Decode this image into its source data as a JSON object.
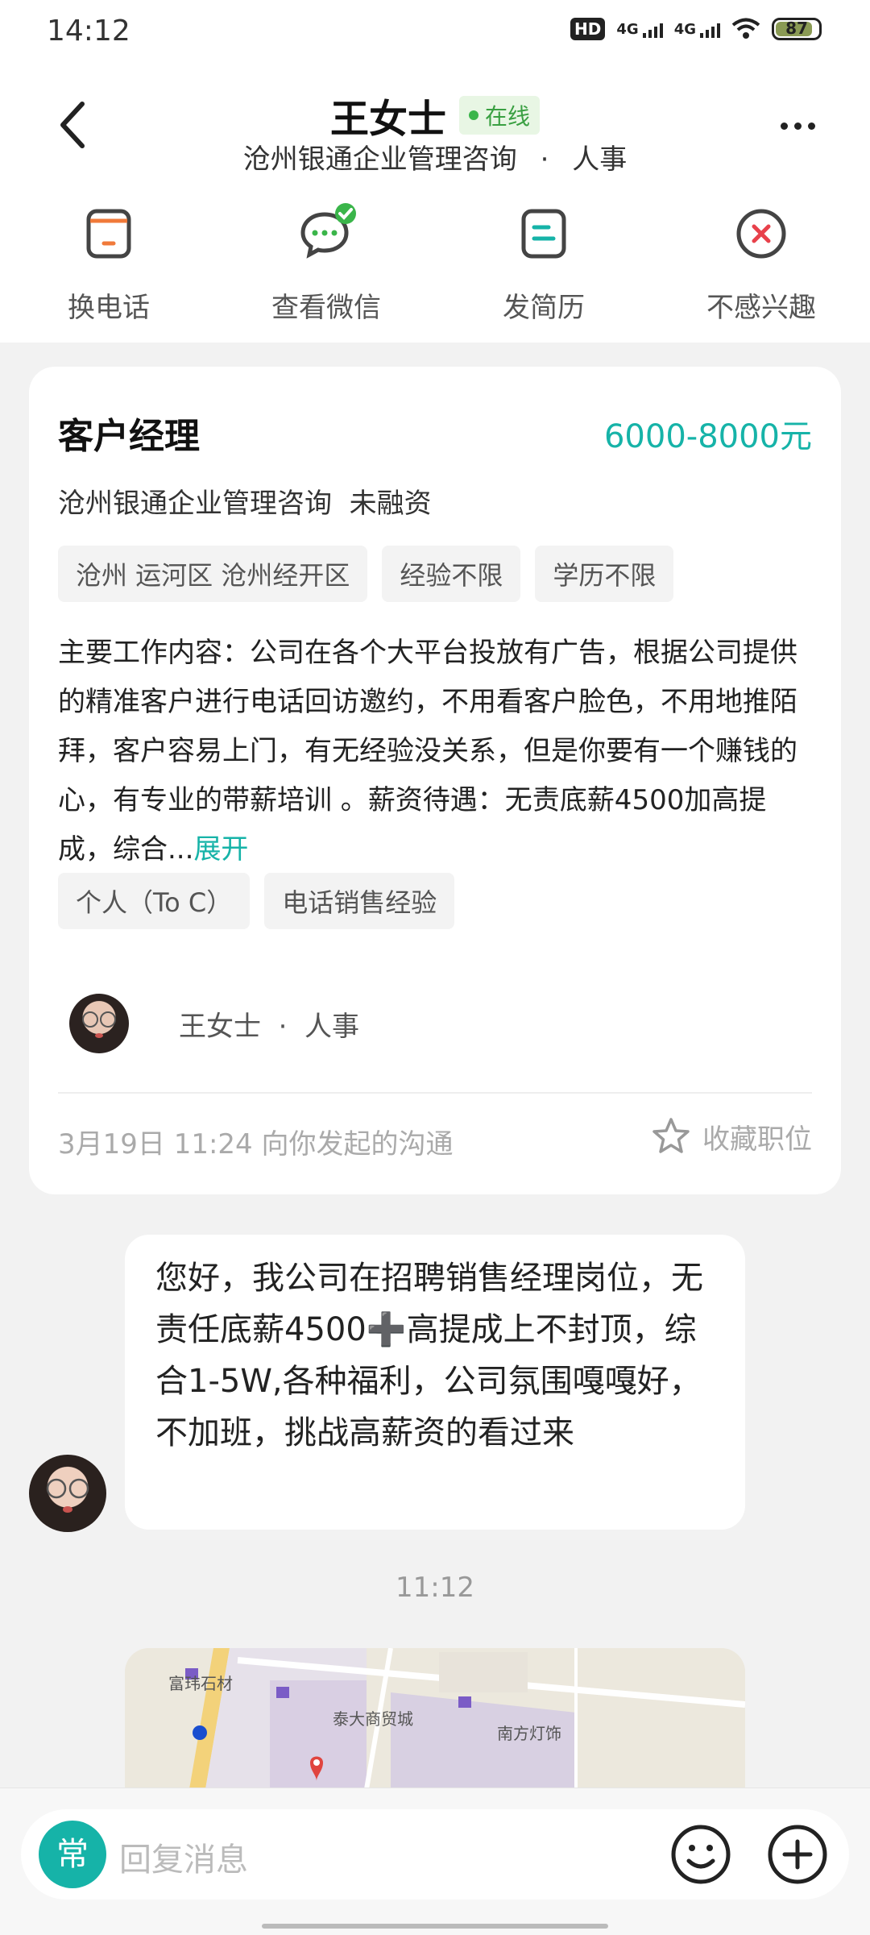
{
  "status_bar": {
    "time": "14:12",
    "hd": "HD",
    "net1": "4G",
    "net2": "4G",
    "battery": "87",
    "battery_level": 0.87
  },
  "header": {
    "name": "王女士",
    "online": "在线",
    "company": "沧州银通企业管理咨询",
    "role_sep": "·",
    "role": "人事"
  },
  "actions": [
    {
      "label": "换电话",
      "icon": "phone-swap-icon"
    },
    {
      "label": "查看微信",
      "icon": "wechat-icon"
    },
    {
      "label": "发简历",
      "icon": "resume-icon"
    },
    {
      "label": "不感兴趣",
      "icon": "not-interested-icon"
    }
  ],
  "job": {
    "title": "客户经理",
    "salary": "6000-8000元",
    "company_line": "沧州银通企业管理咨询  未融资",
    "tags": [
      "沧州 运河区 沧州经开区",
      "经验不限",
      "学历不限"
    ],
    "description": "主要工作内容：公司在各个大平台投放有广告，根据公司提供的精准客户进行电话回访邀约，不用看客户脸色，不用地推陌拜，客户容易上门，有无经验没关系，但是你要有一个赚钱的心，有专业的带薪培训  。薪资待遇：无责底薪4500加高提成，综合...",
    "expand": "展开",
    "skill_tags": [
      "个人（To C）",
      "电话销售经验"
    ],
    "recruiter": "王女士  ·  人事",
    "footer_text": "3月19日 11:24 向你发起的沟通",
    "fav_label": "收藏职位"
  },
  "chat": {
    "message": "您好，我公司在招聘销售经理岗位，无责任底薪4500➕高提成上不封顶，综合1-5W,各种福利，公司氛围嘎嘎好，不加班，挑战高薪资的看过来",
    "time": "11:12",
    "map_labels": [
      "富玮石材",
      "泰大商贸城",
      "南方灯饰"
    ]
  },
  "input": {
    "quick": "常",
    "placeholder": "回复消息"
  },
  "colors": {
    "accent": "#16b3a8",
    "online": "#3ab54a",
    "orange": "#f07a3a",
    "red": "#e8414b"
  }
}
